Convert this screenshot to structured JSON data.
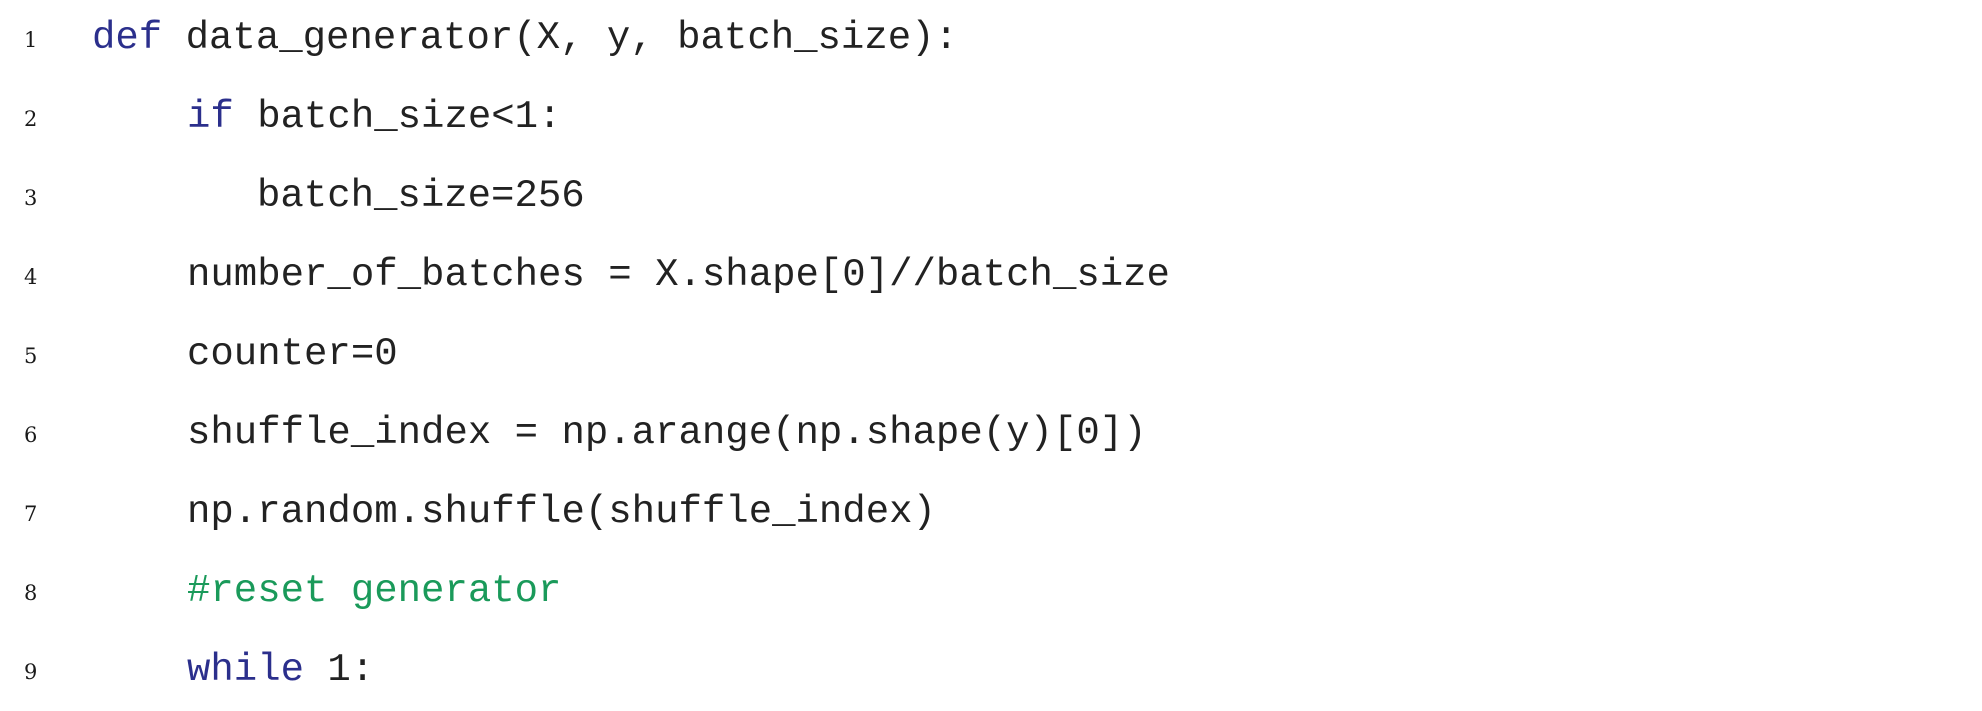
{
  "colors": {
    "keyword": "#2b2f8c",
    "comment": "#1a9a5a",
    "text": "#222222",
    "line_number": "#1a1a1a"
  },
  "lines": [
    {
      "number": "1",
      "keyword": "def",
      "rest": " data_generator(X, y, batch_size):"
    },
    {
      "number": "2",
      "keyword": "if",
      "rest": " batch_size<1:"
    },
    {
      "number": "3",
      "text": "batch_size=256"
    },
    {
      "number": "4",
      "text": "number_of_batches = X.shape[0]//batch_size"
    },
    {
      "number": "5",
      "text": "counter=0"
    },
    {
      "number": "6",
      "text": "shuffle_index = np.arange(np.shape(y)[0])"
    },
    {
      "number": "7",
      "text": "np.random.shuffle(shuffle_index)"
    },
    {
      "number": "8",
      "comment": "#reset generator"
    },
    {
      "number": "9",
      "keyword": "while",
      "rest": " 1:"
    }
  ]
}
